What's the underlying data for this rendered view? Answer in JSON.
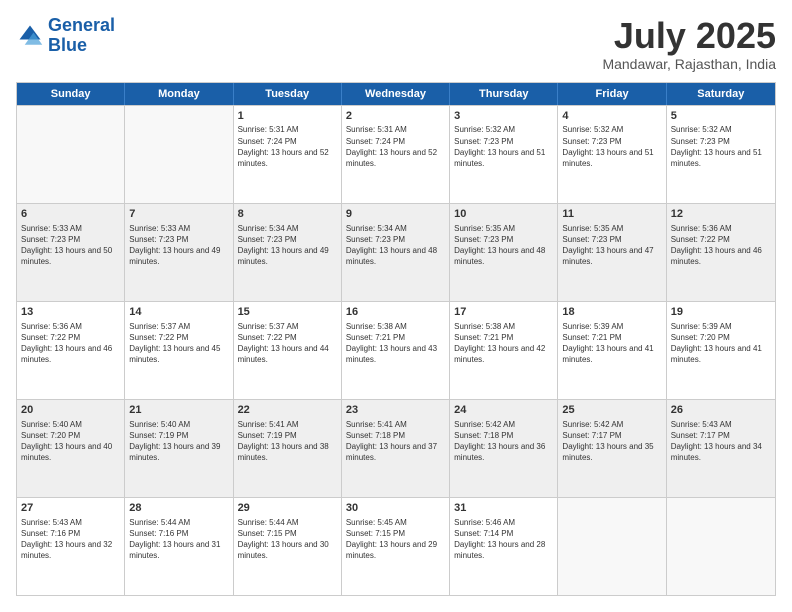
{
  "logo": {
    "line1": "General",
    "line2": "Blue"
  },
  "header": {
    "month": "July 2025",
    "location": "Mandawar, Rajasthan, India"
  },
  "days": [
    "Sunday",
    "Monday",
    "Tuesday",
    "Wednesday",
    "Thursday",
    "Friday",
    "Saturday"
  ],
  "weeks": [
    [
      {
        "day": "",
        "content": ""
      },
      {
        "day": "",
        "content": ""
      },
      {
        "day": "1",
        "content": "Sunrise: 5:31 AM\nSunset: 7:24 PM\nDaylight: 13 hours and 52 minutes."
      },
      {
        "day": "2",
        "content": "Sunrise: 5:31 AM\nSunset: 7:24 PM\nDaylight: 13 hours and 52 minutes."
      },
      {
        "day": "3",
        "content": "Sunrise: 5:32 AM\nSunset: 7:23 PM\nDaylight: 13 hours and 51 minutes."
      },
      {
        "day": "4",
        "content": "Sunrise: 5:32 AM\nSunset: 7:23 PM\nDaylight: 13 hours and 51 minutes."
      },
      {
        "day": "5",
        "content": "Sunrise: 5:32 AM\nSunset: 7:23 PM\nDaylight: 13 hours and 51 minutes."
      }
    ],
    [
      {
        "day": "6",
        "content": "Sunrise: 5:33 AM\nSunset: 7:23 PM\nDaylight: 13 hours and 50 minutes."
      },
      {
        "day": "7",
        "content": "Sunrise: 5:33 AM\nSunset: 7:23 PM\nDaylight: 13 hours and 49 minutes."
      },
      {
        "day": "8",
        "content": "Sunrise: 5:34 AM\nSunset: 7:23 PM\nDaylight: 13 hours and 49 minutes."
      },
      {
        "day": "9",
        "content": "Sunrise: 5:34 AM\nSunset: 7:23 PM\nDaylight: 13 hours and 48 minutes."
      },
      {
        "day": "10",
        "content": "Sunrise: 5:35 AM\nSunset: 7:23 PM\nDaylight: 13 hours and 48 minutes."
      },
      {
        "day": "11",
        "content": "Sunrise: 5:35 AM\nSunset: 7:23 PM\nDaylight: 13 hours and 47 minutes."
      },
      {
        "day": "12",
        "content": "Sunrise: 5:36 AM\nSunset: 7:22 PM\nDaylight: 13 hours and 46 minutes."
      }
    ],
    [
      {
        "day": "13",
        "content": "Sunrise: 5:36 AM\nSunset: 7:22 PM\nDaylight: 13 hours and 46 minutes."
      },
      {
        "day": "14",
        "content": "Sunrise: 5:37 AM\nSunset: 7:22 PM\nDaylight: 13 hours and 45 minutes."
      },
      {
        "day": "15",
        "content": "Sunrise: 5:37 AM\nSunset: 7:22 PM\nDaylight: 13 hours and 44 minutes."
      },
      {
        "day": "16",
        "content": "Sunrise: 5:38 AM\nSunset: 7:21 PM\nDaylight: 13 hours and 43 minutes."
      },
      {
        "day": "17",
        "content": "Sunrise: 5:38 AM\nSunset: 7:21 PM\nDaylight: 13 hours and 42 minutes."
      },
      {
        "day": "18",
        "content": "Sunrise: 5:39 AM\nSunset: 7:21 PM\nDaylight: 13 hours and 41 minutes."
      },
      {
        "day": "19",
        "content": "Sunrise: 5:39 AM\nSunset: 7:20 PM\nDaylight: 13 hours and 41 minutes."
      }
    ],
    [
      {
        "day": "20",
        "content": "Sunrise: 5:40 AM\nSunset: 7:20 PM\nDaylight: 13 hours and 40 minutes."
      },
      {
        "day": "21",
        "content": "Sunrise: 5:40 AM\nSunset: 7:19 PM\nDaylight: 13 hours and 39 minutes."
      },
      {
        "day": "22",
        "content": "Sunrise: 5:41 AM\nSunset: 7:19 PM\nDaylight: 13 hours and 38 minutes."
      },
      {
        "day": "23",
        "content": "Sunrise: 5:41 AM\nSunset: 7:18 PM\nDaylight: 13 hours and 37 minutes."
      },
      {
        "day": "24",
        "content": "Sunrise: 5:42 AM\nSunset: 7:18 PM\nDaylight: 13 hours and 36 minutes."
      },
      {
        "day": "25",
        "content": "Sunrise: 5:42 AM\nSunset: 7:17 PM\nDaylight: 13 hours and 35 minutes."
      },
      {
        "day": "26",
        "content": "Sunrise: 5:43 AM\nSunset: 7:17 PM\nDaylight: 13 hours and 34 minutes."
      }
    ],
    [
      {
        "day": "27",
        "content": "Sunrise: 5:43 AM\nSunset: 7:16 PM\nDaylight: 13 hours and 32 minutes."
      },
      {
        "day": "28",
        "content": "Sunrise: 5:44 AM\nSunset: 7:16 PM\nDaylight: 13 hours and 31 minutes."
      },
      {
        "day": "29",
        "content": "Sunrise: 5:44 AM\nSunset: 7:15 PM\nDaylight: 13 hours and 30 minutes."
      },
      {
        "day": "30",
        "content": "Sunrise: 5:45 AM\nSunset: 7:15 PM\nDaylight: 13 hours and 29 minutes."
      },
      {
        "day": "31",
        "content": "Sunrise: 5:46 AM\nSunset: 7:14 PM\nDaylight: 13 hours and 28 minutes."
      },
      {
        "day": "",
        "content": ""
      },
      {
        "day": "",
        "content": ""
      }
    ]
  ]
}
